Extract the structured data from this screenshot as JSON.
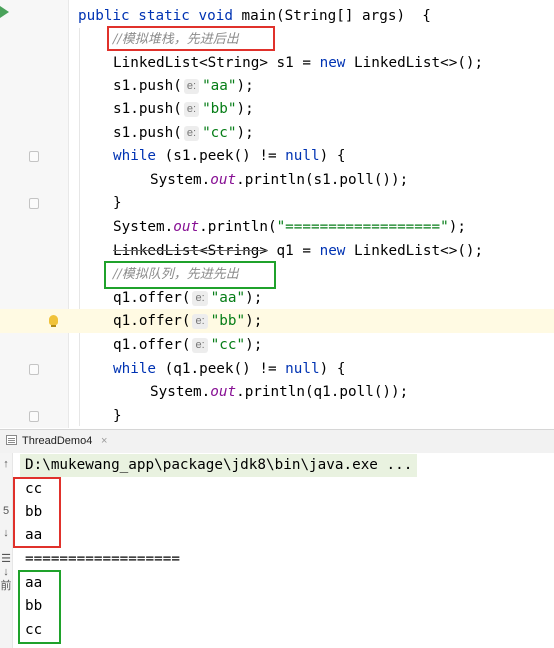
{
  "editor": {
    "lines": [
      {
        "segments": [
          {
            "t": "public static void ",
            "c": "kw"
          },
          {
            "t": "main(String[] args)  {"
          }
        ]
      },
      {
        "segments": [
          {
            "t": "//模拟堆栈，先进后出",
            "c": "cmt"
          }
        ]
      },
      {
        "segments": [
          {
            "t": "LinkedList<String> s1 = "
          },
          {
            "t": "new",
            "c": "kw"
          },
          {
            "t": " LinkedList<>();"
          }
        ]
      },
      {
        "segments": [
          {
            "t": "s1.push("
          },
          {
            "t": "e:",
            "c": "hint"
          },
          {
            "t": "\"aa\"",
            "c": "str"
          },
          {
            "t": ");"
          }
        ]
      },
      {
        "segments": [
          {
            "t": "s1.push("
          },
          {
            "t": "e:",
            "c": "hint"
          },
          {
            "t": "\"bb\"",
            "c": "str"
          },
          {
            "t": ");"
          }
        ]
      },
      {
        "segments": [
          {
            "t": "s1.push("
          },
          {
            "t": "e:",
            "c": "hint"
          },
          {
            "t": "\"cc\"",
            "c": "str"
          },
          {
            "t": ");"
          }
        ]
      },
      {
        "segments": [
          {
            "t": "while",
            "c": "kw"
          },
          {
            "t": " (s1.peek() != "
          },
          {
            "t": "null",
            "c": "kw"
          },
          {
            "t": ") {"
          }
        ]
      },
      {
        "segments": [
          {
            "t": "System."
          },
          {
            "t": "out",
            "c": "field"
          },
          {
            "t": ".println(s1.poll());"
          }
        ]
      },
      {
        "segments": [
          {
            "t": "}"
          }
        ]
      },
      {
        "segments": [
          {
            "t": "System."
          },
          {
            "t": "out",
            "c": "field"
          },
          {
            "t": ".println("
          },
          {
            "t": "\"==================\"",
            "c": "str"
          },
          {
            "t": ");"
          }
        ]
      },
      {
        "segments": [
          {
            "t": "LinkedList<String>",
            "c": "strike"
          },
          {
            "t": " q1 = "
          },
          {
            "t": "new",
            "c": "kw"
          },
          {
            "t": " LinkedList<>();"
          }
        ]
      },
      {
        "segments": [
          {
            "t": "//模拟队列，先进先出",
            "c": "cmt"
          }
        ]
      },
      {
        "segments": [
          {
            "t": "q1.offer("
          },
          {
            "t": "e:",
            "c": "hint"
          },
          {
            "t": "\"aa\"",
            "c": "str"
          },
          {
            "t": ");"
          }
        ]
      },
      {
        "segments": [
          {
            "t": "q1.offer("
          },
          {
            "t": "e:",
            "c": "hint"
          },
          {
            "t": "\"bb\"",
            "c": "str"
          },
          {
            "t": ");"
          }
        ]
      },
      {
        "segments": [
          {
            "t": "q1.offer("
          },
          {
            "t": "e:",
            "c": "hint"
          },
          {
            "t": "\"cc\"",
            "c": "str"
          },
          {
            "t": ");"
          }
        ]
      },
      {
        "segments": [
          {
            "t": "while",
            "c": "kw"
          },
          {
            "t": " (q1.peek() != "
          },
          {
            "t": "null",
            "c": "kw"
          },
          {
            "t": ") {"
          }
        ]
      },
      {
        "segments": [
          {
            "t": "System."
          },
          {
            "t": "out",
            "c": "field"
          },
          {
            "t": ".println(q1.poll());"
          }
        ]
      },
      {
        "segments": [
          {
            "t": "}"
          }
        ]
      }
    ]
  },
  "run_tab": {
    "label": "ThreadDemo4",
    "close": "×"
  },
  "console": {
    "command": "D:\\mukewang_app\\package\\jdk8\\bin\\java.exe ...",
    "output": [
      "cc",
      "bb",
      "aa",
      "==================",
      "aa",
      "bb",
      "cc"
    ],
    "gutter_chars": [
      "↑",
      "5",
      "↓",
      "☰",
      "↓",
      "前"
    ]
  },
  "colors": {
    "keyword": "#0033b3",
    "string": "#067d17",
    "field": "#871094",
    "comment": "#8c8c8c",
    "red_box": "#e0312b",
    "green_box": "#1fa22b"
  }
}
